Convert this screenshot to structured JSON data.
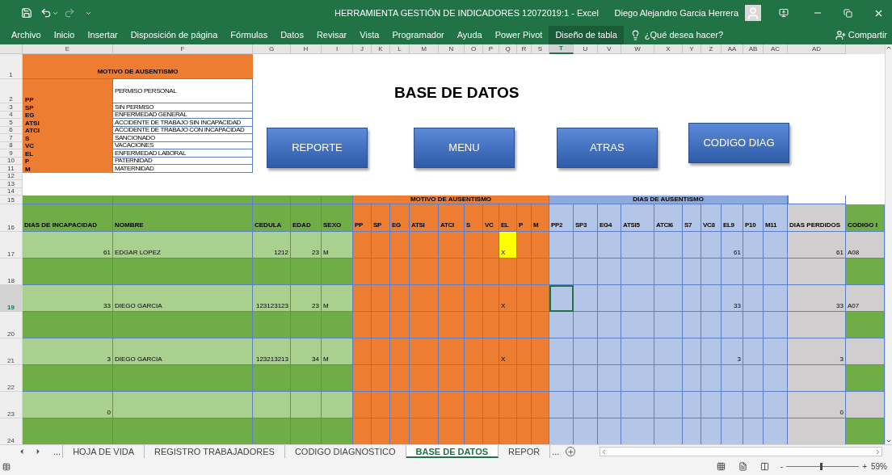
{
  "window": {
    "title": "HERRAMIENTA GESTIÓN DE INDICADORES 12072019:1  -  Excel",
    "user": "Diego Alejandro Garcia Herrera"
  },
  "ribbon_tabs": [
    {
      "label": "Archivo",
      "selected": false
    },
    {
      "label": "Inicio",
      "selected": false
    },
    {
      "label": "Insertar",
      "selected": false
    },
    {
      "label": "Disposición de página",
      "selected": false
    },
    {
      "label": "Fórmulas",
      "selected": false
    },
    {
      "label": "Datos",
      "selected": false
    },
    {
      "label": "Revisar",
      "selected": false
    },
    {
      "label": "Vista",
      "selected": false
    },
    {
      "label": "Programador",
      "selected": false
    },
    {
      "label": "Ayuda",
      "selected": false
    },
    {
      "label": "Power Pivot",
      "selected": false
    },
    {
      "label": "Diseño de tabla",
      "selected": true
    }
  ],
  "tell_me": {
    "placeholder": "¿Qué desea hacer?"
  },
  "share": "Compartir",
  "column_headers": [
    {
      "label": "E",
      "selected": false
    },
    {
      "label": "F",
      "selected": false
    },
    {
      "label": "G",
      "selected": false
    },
    {
      "label": "H",
      "selected": false
    },
    {
      "label": "I",
      "selected": false
    },
    {
      "label": "J",
      "selected": false
    },
    {
      "label": "K",
      "selected": false
    },
    {
      "label": "L",
      "selected": false
    },
    {
      "label": "M",
      "selected": false
    },
    {
      "label": "N",
      "selected": false
    },
    {
      "label": "O",
      "selected": false
    },
    {
      "label": "P",
      "selected": false
    },
    {
      "label": "Q",
      "selected": false
    },
    {
      "label": "R",
      "selected": false
    },
    {
      "label": "S",
      "selected": false
    },
    {
      "label": "T",
      "selected": true
    },
    {
      "label": "U",
      "selected": false
    },
    {
      "label": "V",
      "selected": false
    },
    {
      "label": "W",
      "selected": false
    },
    {
      "label": "X",
      "selected": false
    },
    {
      "label": "Y",
      "selected": false
    },
    {
      "label": "Z",
      "selected": false
    },
    {
      "label": "AA",
      "selected": false
    },
    {
      "label": "AB",
      "selected": false
    },
    {
      "label": "AC",
      "selected": false
    },
    {
      "label": "AD",
      "selected": false
    }
  ],
  "legend": {
    "row": "1",
    "title": "MOTIVO DE AUSENTISMO",
    "items": [
      {
        "row": "2",
        "code": "PP",
        "description": "PERMISO PERSONAL"
      },
      {
        "row": "3",
        "code": "SP",
        "description": "SIN PERMISO"
      },
      {
        "row": "4",
        "code": "EG",
        "description": "ENFERMEDAD GENERAL"
      },
      {
        "row": "5",
        "code": "ATSI",
        "description": "ACCIDENTE DE TRABAJO SIN INCAPACIDAD"
      },
      {
        "row": "6",
        "code": "ATCI",
        "description": "ACCIDENTE DE TRABAJO CON INCAPACIDAD"
      },
      {
        "row": "7",
        "code": "S",
        "description": "SANCIONADO"
      },
      {
        "row": "8",
        "code": "VC",
        "description": "VACACIONES"
      },
      {
        "row": "9",
        "code": "EL",
        "description": "ENFERMEDAD LABORAL"
      },
      {
        "row": "10",
        "code": "P",
        "description": "PATERNIDAD"
      },
      {
        "row": "11",
        "code": "M",
        "description": "MATERNIDAD"
      }
    ],
    "empty_rows": [
      "12",
      "13",
      "14"
    ]
  },
  "sheet_title": "BASE DE DATOS",
  "buttons": [
    "REPORTE",
    "MENU",
    "ATRAS",
    "CODIGO DIAG"
  ],
  "table": {
    "group_row": "15",
    "header_row": "16",
    "groups": [
      {
        "kind": "motivo",
        "label": "MOTIVO DE AUSENTISMO"
      },
      {
        "kind": "dias",
        "label": "DIAS DE AUSENTISMO"
      }
    ],
    "columns": [
      {
        "kind": "info",
        "label": "DIAS DE INCAPACIDAD"
      },
      {
        "kind": "info",
        "label": "NOMBRE"
      },
      {
        "kind": "info",
        "label": "CEDULA"
      },
      {
        "kind": "info",
        "label": "EDAD"
      },
      {
        "kind": "info",
        "label": "SEXO"
      },
      {
        "kind": "motivo",
        "label": "PP"
      },
      {
        "kind": "motivo",
        "label": "SP"
      },
      {
        "kind": "motivo",
        "label": "EG"
      },
      {
        "kind": "motivo",
        "label": "ATSI"
      },
      {
        "kind": "motivo",
        "label": "ATCI"
      },
      {
        "kind": "motivo",
        "label": "S"
      },
      {
        "kind": "motivo",
        "label": "VC"
      },
      {
        "kind": "motivo",
        "label": "EL"
      },
      {
        "kind": "motivo",
        "label": "P"
      },
      {
        "kind": "motivo",
        "label": "M"
      },
      {
        "kind": "dias",
        "label": "PP2"
      },
      {
        "kind": "dias",
        "label": "SP3"
      },
      {
        "kind": "dias",
        "label": "EG4"
      },
      {
        "kind": "dias",
        "label": "ATSI5"
      },
      {
        "kind": "dias",
        "label": "ATCI6"
      },
      {
        "kind": "dias",
        "label": "S7"
      },
      {
        "kind": "dias",
        "label": "VC8"
      },
      {
        "kind": "dias",
        "label": "EL9"
      },
      {
        "kind": "dias",
        "label": "P10"
      },
      {
        "kind": "dias",
        "label": "M11"
      },
      {
        "kind": "perdidos",
        "label": "DIAS PERDIDOS"
      },
      {
        "kind": "codigo",
        "label": "CODIGO I"
      }
    ],
    "rows": [
      {
        "row": "17",
        "selected": false,
        "dias_incapacidad": "61",
        "nombre": "EDGAR LOPEZ",
        "cedula": "1212",
        "edad": "23",
        "sexo": "M",
        "motivo": {
          "el": {
            "text": "X",
            "highlighted": true
          }
        },
        "dias": {
          "el9": {
            "text": "61",
            "selected": false
          }
        },
        "dias_perdidos": "61",
        "codigo": "A08"
      },
      {
        "row": "18",
        "selected": false
      },
      {
        "row": "19",
        "selected": true,
        "dias_incapacidad": "33",
        "nombre": "DIEGO GARCIA",
        "cedula": "123123123",
        "edad": "23",
        "sexo": "M",
        "motivo": {
          "el": {
            "text": "X",
            "highlighted": false
          }
        },
        "dias": {
          "pp2": {
            "selected": true
          },
          "el9": {
            "text": "33",
            "selected": false
          }
        },
        "dias_perdidos": "33",
        "codigo": "A07"
      },
      {
        "row": "20",
        "selected": false
      },
      {
        "row": "21",
        "selected": false,
        "dias_incapacidad": "3",
        "nombre": "DIEGO GARCIA",
        "cedula": "123213213",
        "edad": "34",
        "sexo": "M",
        "motivo": {
          "el": {
            "text": "X",
            "highlighted": false
          }
        },
        "dias": {
          "el9": {
            "text": "3",
            "selected": false
          }
        },
        "dias_perdidos": "3"
      },
      {
        "row": "22",
        "selected": false
      },
      {
        "row": "23",
        "selected": false,
        "dias_incapacidad": "0",
        "dias_perdidos": "0"
      },
      {
        "row": "24",
        "selected": false
      }
    ]
  },
  "sheet_tabs": [
    {
      "label": "HOJA DE VIDA",
      "selected": false
    },
    {
      "label": "REGISTRO TRABAJADORES",
      "selected": false
    },
    {
      "label": "CODIGO DIAGNOSTICO",
      "selected": false
    },
    {
      "label": "BASE DE DATOS",
      "selected": true
    },
    {
      "label": "REPOR",
      "selected": false
    }
  ],
  "tab_overflow": "...",
  "tab_overflow_right": "...",
  "zoom": {
    "minus": "-",
    "plus": "+",
    "level": 0.46,
    "reading": "59%"
  }
}
